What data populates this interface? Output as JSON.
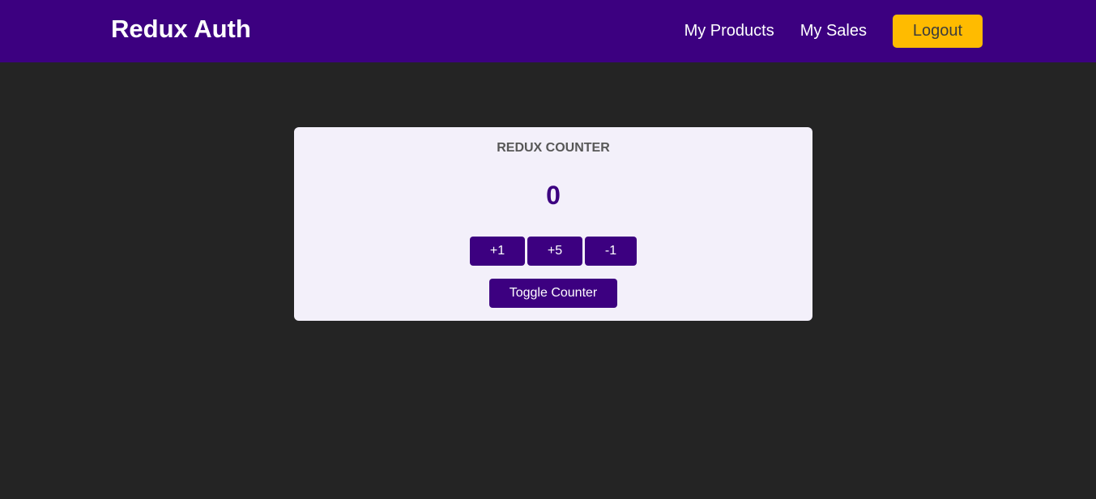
{
  "header": {
    "brand": "Redux Auth",
    "nav": {
      "products": "My Products",
      "sales": "My Sales",
      "logout": "Logout"
    }
  },
  "counter": {
    "title": "REDUX COUNTER",
    "value": "0",
    "buttons": {
      "increment": "+1",
      "increase": "+5",
      "decrement": "-1",
      "toggle": "Toggle Counter"
    }
  },
  "colors": {
    "background": "#242424",
    "header": "#3c0080",
    "accent": "#ffbb00",
    "card": "#f3f0fa"
  }
}
